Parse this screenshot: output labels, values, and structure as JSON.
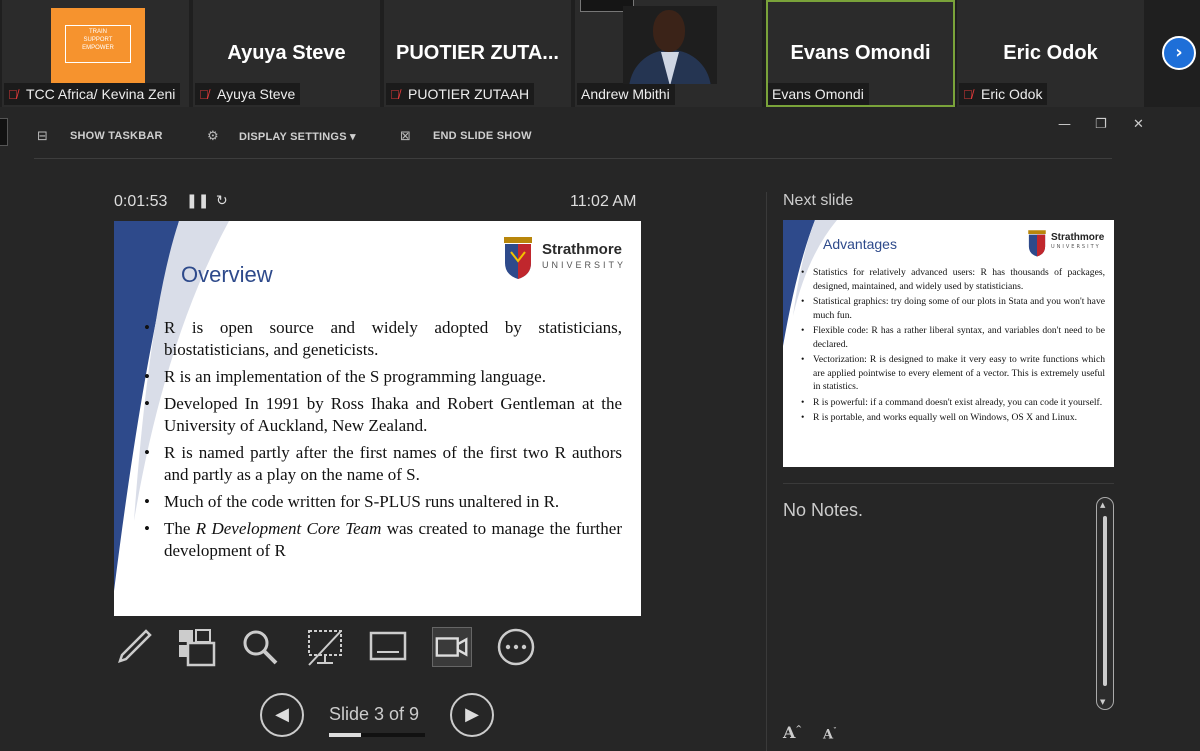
{
  "participants": [
    {
      "name": "TCC Africa/ Kevina Zeni",
      "logo_lines": [
        "TRAIN",
        "SUPPORT",
        "EMPOWER"
      ],
      "muted": true
    },
    {
      "name": "Ayuya Steve",
      "display": "Ayuya Steve",
      "muted": true
    },
    {
      "name": "PUOTIER ZUTAAH",
      "display": "PUOTIER  ZUTA...",
      "muted": true
    },
    {
      "name": "Andrew Mbithi",
      "muted": false
    },
    {
      "name": "Evans Omondi",
      "display": "Evans Omondi",
      "muted": false,
      "active": true
    },
    {
      "name": "Eric Odok",
      "display": "Eric Odok",
      "muted": true
    }
  ],
  "toolbar": {
    "show_taskbar": "SHOW TASKBAR",
    "display_settings": "DISPLAY SETTINGS ▾",
    "end_slide_show": "END SLIDE SHOW"
  },
  "timer": {
    "elapsed": "0:01:53",
    "clock": "11:02 AM"
  },
  "current_slide": {
    "title": "Overview",
    "university_name": "Strathmore",
    "university_sub": "UNIVERSITY",
    "bullets": [
      {
        "text": "R is open source and widely adopted by statisticians, biostatisticians, and geneticists."
      },
      {
        "text": "R is an implementation of the S programming language."
      },
      {
        "text": "Developed In 1991 by Ross Ihaka and Robert Gentleman at the University of Auckland, New Zealand."
      },
      {
        "text": "R is named partly after the first names of the first two R authors and partly as a play on the name of S."
      },
      {
        "text": "Much of the code written for S-PLUS runs unaltered in R."
      },
      {
        "pre": "The ",
        "italic": "R Development Core Team",
        "post": " was created to manage the further development of R"
      }
    ]
  },
  "navigation": {
    "label": "Slide 3 of 9",
    "current": 3,
    "total": 9
  },
  "next_slide": {
    "label": "Next slide",
    "title": "Advantages",
    "university_name": "Strathmore",
    "university_sub": "UNIVERSITY",
    "bullets": [
      "Statistics for relatively advanced users:  R has thousands of packages, designed, maintained, and widely used by statisticians.",
      "Statistical graphics: try doing some of our plots in Stata and you won't have much fun.",
      "Flexible code: R has a rather liberal syntax, and variables don't need to be declared.",
      "Vectorization: R is designed to make it very easy to write functions which are applied pointwise to every element of a vector. This is extremely useful in statistics.",
      "R is powerful: if a command doesn't exist already, you can code it yourself.",
      "R is portable, and works equally well on Windows, OS X and Linux."
    ]
  },
  "notes": {
    "text": "No Notes."
  },
  "colors": {
    "accent_blue": "#2e4a8b",
    "active_border": "#7aa33a",
    "muted_red": "#e03a3a",
    "nav_blue": "#1e6fd8"
  }
}
